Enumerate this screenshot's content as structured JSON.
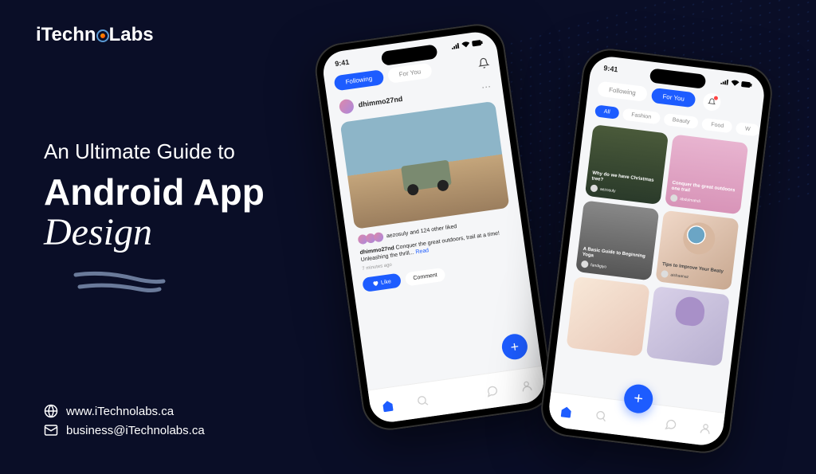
{
  "brand": {
    "name_pre": "iTechn",
    "name_post": "Labs"
  },
  "heading": {
    "line1": "An Ultimate Guide to",
    "line2": "Android App",
    "line3": "Design"
  },
  "contact": {
    "website": "www.iTechnolabs.ca",
    "email": "business@iTechnolabs.ca"
  },
  "phone1": {
    "time": "9:41",
    "tab_following": "Following",
    "tab_foryou": "For You",
    "username": "dhimmo27nd",
    "likes_text": "aezosuly and 124 other liked",
    "caption_user": "dhimmo27nd",
    "caption_text": "Conquer the great outdoors, trail at a time! Unleashing the thrill...",
    "caption_more": "Read",
    "timestamp": "7 minutes ago",
    "like_label": "Like",
    "comment_label": "Comment"
  },
  "phone2": {
    "time": "9:41",
    "tab_following": "Following",
    "tab_foryou": "For You",
    "chips": [
      "All",
      "Fashion",
      "Beauty",
      "Food",
      "W"
    ],
    "cards": [
      {
        "title": "Why do we have Christmas tree?",
        "user": "aezosuly"
      },
      {
        "title": "Conquer the great outdoors one trail",
        "user": "abdulmahdi"
      },
      {
        "title": "A Basic Guide to Beginning Yoga",
        "user": "fandigiyo"
      },
      {
        "title": "Tips to Improve Your Beaty",
        "user": "aishaanaz"
      }
    ]
  }
}
